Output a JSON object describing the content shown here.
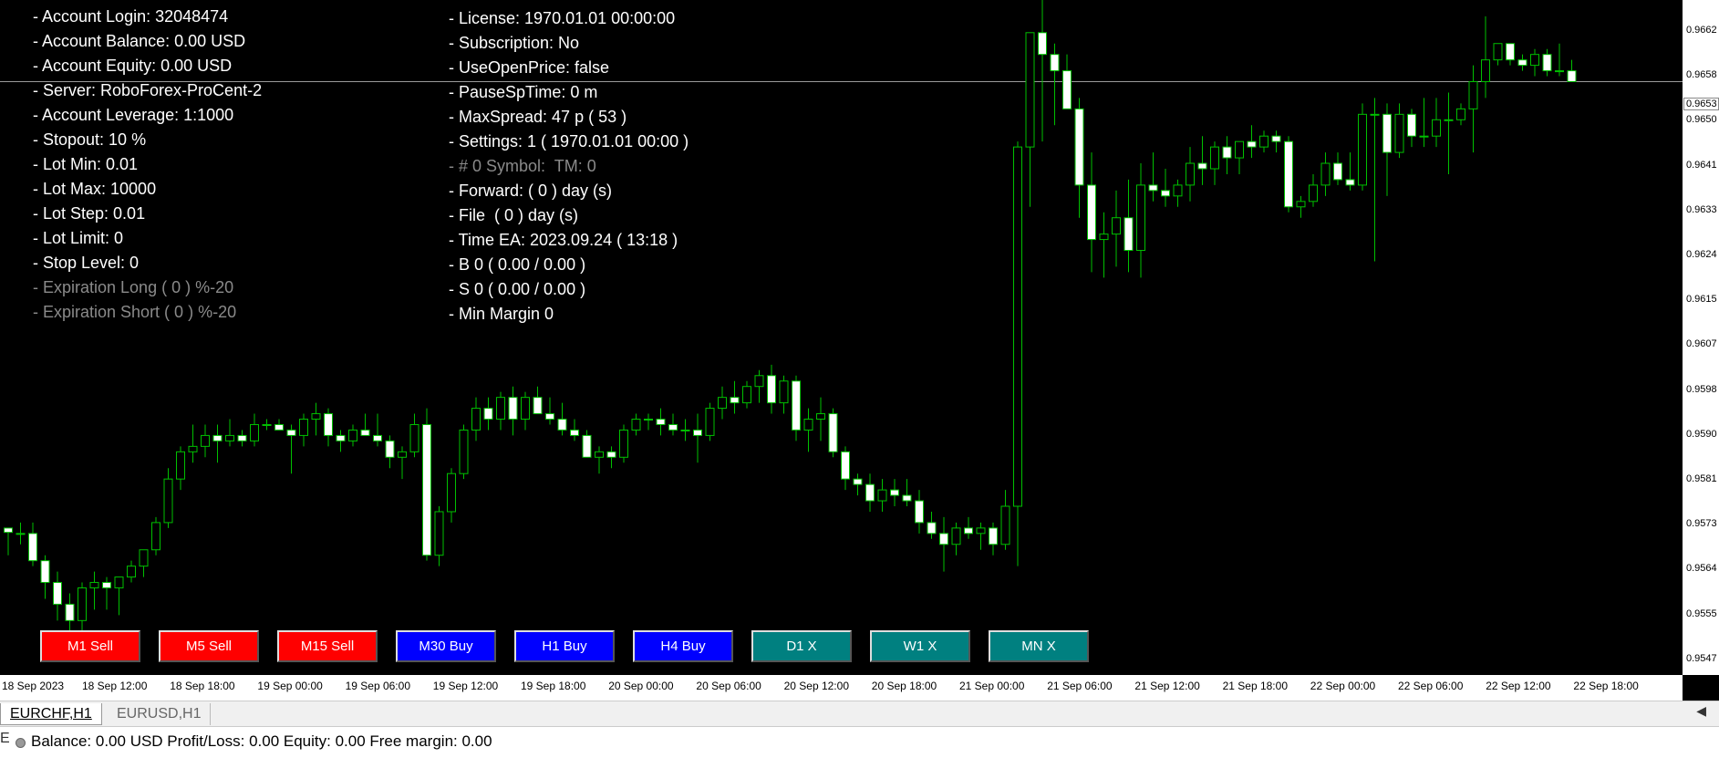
{
  "account_info": [
    {
      "text": "- Account Login: 32048474",
      "dim": false
    },
    {
      "text": "- Account Balance: 0.00 USD",
      "dim": false
    },
    {
      "text": "- Account Equity: 0.00 USD",
      "dim": false
    },
    {
      "text": "- Server: RoboForex-ProCent-2",
      "dim": false
    },
    {
      "text": "- Account Leverage: 1:1000",
      "dim": false
    },
    {
      "text": "- Stopout: 10 %",
      "dim": false
    },
    {
      "text": "- Lot Min: 0.01",
      "dim": false
    },
    {
      "text": "- Lot Max: 10000",
      "dim": false
    },
    {
      "text": "- Lot Step: 0.01",
      "dim": false
    },
    {
      "text": "- Lot Limit: 0",
      "dim": false
    },
    {
      "text": "- Stop Level: 0",
      "dim": false
    },
    {
      "text": "- Expiration Long ( 0 ) %-20",
      "dim": true
    },
    {
      "text": "- Expiration Short ( 0 ) %-20",
      "dim": true
    }
  ],
  "ea_info": [
    {
      "text": "- License: 1970.01.01 00:00:00",
      "dim": false
    },
    {
      "text": "- Subscription: No",
      "dim": false
    },
    {
      "text": "- UseOpenPrice: false",
      "dim": false
    },
    {
      "text": "- PauseSpTime: 0 m",
      "dim": false
    },
    {
      "text": "- MaxSpread: 47 p ( 53 )",
      "dim": false
    },
    {
      "text": "- Settings: 1 ( 1970.01.01 00:00 )",
      "dim": false
    },
    {
      "text": "- # 0 Symbol:  TM: 0",
      "dim": true
    },
    {
      "text": "- Forward: ( 0 ) day (s)",
      "dim": false
    },
    {
      "text": "- File  ( 0 ) day (s)",
      "dim": false
    },
    {
      "text": "- Time EA: 2023.09.24 ( 13:18 )",
      "dim": false
    },
    {
      "text": "- B 0 ( 0.00 / 0.00 )",
      "dim": false
    },
    {
      "text": "- S 0 ( 0.00 / 0.00 )",
      "dim": false
    },
    {
      "text": "- Min Margin 0",
      "dim": false
    }
  ],
  "buttons": [
    {
      "label": "M1 Sell",
      "color": "#ff0000"
    },
    {
      "label": "M5 Sell",
      "color": "#ff0000"
    },
    {
      "label": "M15 Sell",
      "color": "#ff0000"
    },
    {
      "label": "M30 Buy",
      "color": "#0000ff"
    },
    {
      "label": "H1 Buy",
      "color": "#0000ff"
    },
    {
      "label": "H4 Buy",
      "color": "#0000ff"
    },
    {
      "label": "D1 X",
      "color": "#008080"
    },
    {
      "label": "W1 X",
      "color": "#008080"
    },
    {
      "label": "MN X",
      "color": "#008080"
    }
  ],
  "time_labels": [
    "18 Sep 2023",
    "18 Sep 12:00",
    "18 Sep 18:00",
    "19 Sep 00:00",
    "19 Sep 06:00",
    "19 Sep 12:00",
    "19 Sep 18:00",
    "20 Sep 00:00",
    "20 Sep 06:00",
    "20 Sep 12:00",
    "20 Sep 18:00",
    "21 Sep 00:00",
    "21 Sep 06:00",
    "21 Sep 12:00",
    "21 Sep 18:00",
    "22 Sep 00:00",
    "22 Sep 06:00",
    "22 Sep 12:00",
    "22 Sep 18:00"
  ],
  "price_labels": [
    "0.9662",
    "0.9658",
    "0.9650",
    "0.9641",
    "0.9633",
    "0.9624",
    "0.9615",
    "0.9607",
    "0.9598",
    "0.9590",
    "0.9581",
    "0.9573",
    "0.9564",
    "0.9555",
    "0.9547"
  ],
  "current_price": "0.9653",
  "tabs": {
    "active": "EURCHF,H1",
    "other": "EURUSD,H1",
    "scroll_icon": "◀"
  },
  "status": {
    "text": "Balance: 0.00 USD  Profit/Loss: 0.00  Equity: 0.00  Free margin: 0.00",
    "left_mark": "E"
  },
  "colors": {
    "bull_candle": "#000000",
    "bear_candle": "#ffffff",
    "wick": "#00c000",
    "background": "#000000",
    "info_text": "#ffffff"
  },
  "chart_data": {
    "type": "candlestick",
    "symbol": "EURCHF",
    "timeframe": "H1",
    "price_range": [
      0.9544,
      0.9668
    ],
    "candles": [
      [
        0.9571,
        0.957,
        0.9566,
        0.95702
      ],
      [
        0.957,
        0.9572,
        0.9568,
        0.957
      ],
      [
        0.957,
        0.9572,
        0.9564,
        0.9565
      ],
      [
        0.9565,
        0.9566,
        0.9558,
        0.9561
      ],
      [
        0.9561,
        0.9563,
        0.9554,
        0.9557
      ],
      [
        0.9557,
        0.9559,
        0.955,
        0.9554
      ],
      [
        0.9554,
        0.9561,
        0.9552,
        0.956
      ],
      [
        0.956,
        0.9563,
        0.9556,
        0.9561
      ],
      [
        0.9561,
        0.9562,
        0.9556,
        0.956
      ],
      [
        0.956,
        0.9562,
        0.9555,
        0.9562
      ],
      [
        0.9562,
        0.9565,
        0.9561,
        0.9564
      ],
      [
        0.9564,
        0.9567,
        0.9562,
        0.9567
      ],
      [
        0.9567,
        0.9573,
        0.9566,
        0.9572
      ],
      [
        0.9572,
        0.9582,
        0.9571,
        0.958
      ],
      [
        0.958,
        0.9586,
        0.9578,
        0.9585
      ],
      [
        0.9585,
        0.959,
        0.9583,
        0.9586
      ],
      [
        0.9586,
        0.959,
        0.9584,
        0.9588
      ],
      [
        0.9588,
        0.959,
        0.9583,
        0.9587
      ],
      [
        0.9587,
        0.9591,
        0.9586,
        0.9588
      ],
      [
        0.9588,
        0.9589,
        0.9586,
        0.9587
      ],
      [
        0.9587,
        0.9592,
        0.9586,
        0.959
      ],
      [
        0.959,
        0.9591,
        0.9589,
        0.959
      ],
      [
        0.959,
        0.9591,
        0.9589,
        0.9589
      ],
      [
        0.9589,
        0.959,
        0.9581,
        0.9588
      ],
      [
        0.9588,
        0.9592,
        0.9586,
        0.9591
      ],
      [
        0.9591,
        0.9594,
        0.9588,
        0.9592
      ],
      [
        0.9592,
        0.9593,
        0.9586,
        0.9588
      ],
      [
        0.9588,
        0.9589,
        0.9585,
        0.9587
      ],
      [
        0.9587,
        0.959,
        0.9586,
        0.9589
      ],
      [
        0.9589,
        0.9592,
        0.9588,
        0.9588
      ],
      [
        0.9588,
        0.9592,
        0.9586,
        0.9587
      ],
      [
        0.9587,
        0.9588,
        0.9582,
        0.9584
      ],
      [
        0.9584,
        0.9586,
        0.958,
        0.9585
      ],
      [
        0.9585,
        0.9592,
        0.9584,
        0.959
      ],
      [
        0.959,
        0.9593,
        0.9565,
        0.9566
      ],
      [
        0.9566,
        0.9575,
        0.9564,
        0.9574
      ],
      [
        0.9574,
        0.9582,
        0.9572,
        0.9581
      ],
      [
        0.9581,
        0.959,
        0.958,
        0.9589
      ],
      [
        0.9589,
        0.9595,
        0.9587,
        0.9593
      ],
      [
        0.9593,
        0.9595,
        0.9589,
        0.9591
      ],
      [
        0.9591,
        0.9596,
        0.9589,
        0.9595
      ],
      [
        0.9595,
        0.9597,
        0.9588,
        0.9591
      ],
      [
        0.9591,
        0.9596,
        0.9589,
        0.9595
      ],
      [
        0.9595,
        0.9597,
        0.9592,
        0.9592
      ],
      [
        0.9592,
        0.9595,
        0.959,
        0.9591
      ],
      [
        0.9591,
        0.9594,
        0.9588,
        0.9589
      ],
      [
        0.9589,
        0.9591,
        0.9587,
        0.9588
      ],
      [
        0.9588,
        0.9589,
        0.9584,
        0.9584
      ],
      [
        0.9584,
        0.9586,
        0.9581,
        0.9585
      ],
      [
        0.9585,
        0.9586,
        0.9582,
        0.9584
      ],
      [
        0.9584,
        0.959,
        0.9583,
        0.9589
      ],
      [
        0.9589,
        0.9592,
        0.9588,
        0.9591
      ],
      [
        0.9591,
        0.9592,
        0.9589,
        0.9591
      ],
      [
        0.9591,
        0.9593,
        0.9588,
        0.959
      ],
      [
        0.959,
        0.9592,
        0.9588,
        0.9589
      ],
      [
        0.9589,
        0.9591,
        0.9587,
        0.9589
      ],
      [
        0.9589,
        0.9592,
        0.9583,
        0.9588
      ],
      [
        0.9588,
        0.9594,
        0.9587,
        0.9593
      ],
      [
        0.9593,
        0.9597,
        0.9591,
        0.9595
      ],
      [
        0.9595,
        0.9598,
        0.9592,
        0.9594
      ],
      [
        0.9594,
        0.9598,
        0.9593,
        0.9597
      ],
      [
        0.9597,
        0.96,
        0.9594,
        0.9599
      ],
      [
        0.9599,
        0.9601,
        0.9592,
        0.9594
      ],
      [
        0.9594,
        0.9599,
        0.9592,
        0.9598
      ],
      [
        0.9598,
        0.9599,
        0.9587,
        0.9589
      ],
      [
        0.9589,
        0.9593,
        0.9585,
        0.9591
      ],
      [
        0.9591,
        0.9595,
        0.9587,
        0.9592
      ],
      [
        0.9592,
        0.9593,
        0.9584,
        0.9585
      ],
      [
        0.9585,
        0.9586,
        0.9578,
        0.958
      ],
      [
        0.958,
        0.9581,
        0.9577,
        0.9579
      ],
      [
        0.9579,
        0.9581,
        0.9574,
        0.9576
      ],
      [
        0.9576,
        0.958,
        0.9574,
        0.9578
      ],
      [
        0.9578,
        0.958,
        0.9575,
        0.9577
      ],
      [
        0.9577,
        0.958,
        0.9575,
        0.9576
      ],
      [
        0.9576,
        0.9578,
        0.957,
        0.9572
      ],
      [
        0.9572,
        0.9574,
        0.9569,
        0.957
      ],
      [
        0.957,
        0.9573,
        0.9563,
        0.9568
      ],
      [
        0.9568,
        0.9572,
        0.9566,
        0.9571
      ],
      [
        0.9571,
        0.9573,
        0.9569,
        0.957
      ],
      [
        0.957,
        0.9572,
        0.9567,
        0.9571
      ],
      [
        0.9571,
        0.9572,
        0.9566,
        0.9568
      ],
      [
        0.9568,
        0.9578,
        0.9567,
        0.9575
      ],
      [
        0.9575,
        0.9642,
        0.9564,
        0.9641
      ],
      [
        0.9641,
        0.966,
        0.963,
        0.9662
      ],
      [
        0.9662,
        0.967,
        0.9642,
        0.9658
      ],
      [
        0.9658,
        0.966,
        0.9645,
        0.9655
      ],
      [
        0.9655,
        0.9658,
        0.9648,
        0.9648
      ],
      [
        0.9648,
        0.965,
        0.9628,
        0.9634
      ],
      [
        0.9634,
        0.964,
        0.9618,
        0.9624
      ],
      [
        0.9624,
        0.9629,
        0.9617,
        0.9625
      ],
      [
        0.9625,
        0.9633,
        0.9619,
        0.9628
      ],
      [
        0.9628,
        0.9635,
        0.9618,
        0.9622
      ],
      [
        0.9622,
        0.9638,
        0.9617,
        0.9634
      ],
      [
        0.9634,
        0.964,
        0.9631,
        0.9633
      ],
      [
        0.9633,
        0.9637,
        0.963,
        0.9632
      ],
      [
        0.9632,
        0.9635,
        0.963,
        0.9634
      ],
      [
        0.9634,
        0.9641,
        0.9631,
        0.9638
      ],
      [
        0.9638,
        0.9643,
        0.9634,
        0.9637
      ],
      [
        0.9637,
        0.9642,
        0.9634,
        0.9641
      ],
      [
        0.9641,
        0.9643,
        0.9636,
        0.9639
      ],
      [
        0.9639,
        0.9642,
        0.9636,
        0.9642
      ],
      [
        0.9642,
        0.9645,
        0.9639,
        0.9641
      ],
      [
        0.9641,
        0.9644,
        0.964,
        0.9643
      ],
      [
        0.9643,
        0.9644,
        0.964,
        0.9642
      ],
      [
        0.9642,
        0.9643,
        0.9629,
        0.963
      ],
      [
        0.963,
        0.9632,
        0.9628,
        0.9631
      ],
      [
        0.9631,
        0.9636,
        0.963,
        0.9634
      ],
      [
        0.9634,
        0.964,
        0.9632,
        0.9638
      ],
      [
        0.9638,
        0.964,
        0.9634,
        0.9635
      ],
      [
        0.9635,
        0.964,
        0.9633,
        0.9634
      ],
      [
        0.9634,
        0.9649,
        0.9633,
        0.9647
      ],
      [
        0.9647,
        0.965,
        0.962,
        0.9647
      ],
      [
        0.9647,
        0.9649,
        0.9632,
        0.964
      ],
      [
        0.964,
        0.9649,
        0.9639,
        0.9647
      ],
      [
        0.9647,
        0.9648,
        0.9641,
        0.9643
      ],
      [
        0.9643,
        0.965,
        0.9641,
        0.9643
      ],
      [
        0.9643,
        0.965,
        0.9641,
        0.9646
      ],
      [
        0.9646,
        0.9651,
        0.9636,
        0.9646
      ],
      [
        0.9646,
        0.9649,
        0.9645,
        0.9648
      ],
      [
        0.9648,
        0.9656,
        0.964,
        0.9653
      ],
      [
        0.9653,
        0.9665,
        0.965,
        0.9657
      ],
      [
        0.9657,
        0.966,
        0.9656,
        0.966
      ],
      [
        0.966,
        0.9659,
        0.9656,
        0.9657
      ],
      [
        0.9657,
        0.9658,
        0.9655,
        0.9656
      ],
      [
        0.9656,
        0.9659,
        0.9654,
        0.9658
      ],
      [
        0.9658,
        0.9659,
        0.9654,
        0.9655
      ],
      [
        0.9655,
        0.966,
        0.9654,
        0.9655
      ],
      [
        0.9655,
        0.9657,
        0.9653,
        0.9653
      ]
    ]
  }
}
